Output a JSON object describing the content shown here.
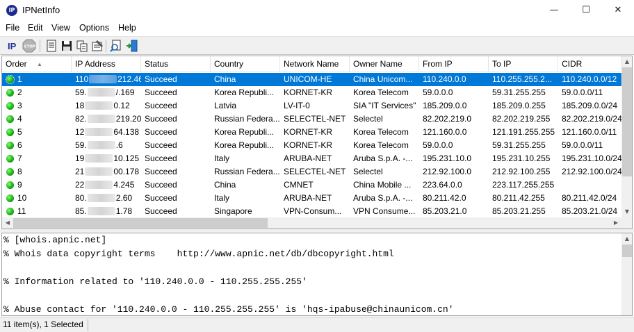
{
  "window": {
    "title": "IPNetInfo",
    "minimize": "—",
    "maximize": "☐",
    "close": "✕",
    "app_icon_text": "IP"
  },
  "menu": [
    "File",
    "Edit",
    "View",
    "Options",
    "Help"
  ],
  "toolbar": {
    "buttons": [
      {
        "name": "ip-lookup-icon",
        "glyph": "IP"
      },
      {
        "name": "stop-icon",
        "glyph": "STOP"
      },
      {
        "name": "text-report-icon",
        "glyph": ""
      },
      {
        "name": "save-icon",
        "glyph": ""
      },
      {
        "name": "copy-icon",
        "glyph": ""
      },
      {
        "name": "properties-icon",
        "glyph": ""
      },
      {
        "name": "find-icon",
        "glyph": ""
      },
      {
        "name": "exit-icon",
        "glyph": ""
      }
    ]
  },
  "columns": [
    "Order",
    "IP Address",
    "Status",
    "Country",
    "Network Name",
    "Owner Name",
    "From IP",
    "To IP",
    "CIDR"
  ],
  "sort_indicator": "▲",
  "rows": [
    {
      "order": "1",
      "ip_start": "110",
      "ip_end": "212.46",
      "status": "Succeed",
      "country": "China",
      "network": "UNICOM-HE",
      "owner": "China Unicom...",
      "from": "110.240.0.0",
      "to": "110.255.255.2...",
      "cidr": "110.240.0.0/12",
      "selected": true
    },
    {
      "order": "2",
      "ip_start": "59.",
      "ip_end": "/.169",
      "status": "Succeed",
      "country": "Korea Republi...",
      "network": "KORNET-KR",
      "owner": "Korea Telecom",
      "from": "59.0.0.0",
      "to": "59.31.255.255",
      "cidr": "59.0.0.0/11"
    },
    {
      "order": "3",
      "ip_start": "18",
      "ip_end": "0.12",
      "status": "Succeed",
      "country": "Latvia",
      "network": "LV-IT-0",
      "owner": "SIA \"IT Services\"",
      "from": "185.209.0.0",
      "to": "185.209.0.255",
      "cidr": "185.209.0.0/24"
    },
    {
      "order": "4",
      "ip_start": "82.",
      "ip_end": "219.202",
      "status": "Succeed",
      "country": "Russian Federa...",
      "network": "SELECTEL-NET",
      "owner": "Selectel",
      "from": "82.202.219.0",
      "to": "82.202.219.255",
      "cidr": "82.202.219.0/24"
    },
    {
      "order": "5",
      "ip_start": "12",
      "ip_end": "64.138",
      "status": "Succeed",
      "country": "Korea Republi...",
      "network": "KORNET-KR",
      "owner": "Korea Telecom",
      "from": "121.160.0.0",
      "to": "121.191.255.255",
      "cidr": "121.160.0.0/11"
    },
    {
      "order": "6",
      "ip_start": "59.",
      "ip_end": ".6",
      "status": "Succeed",
      "country": "Korea Republi...",
      "network": "KORNET-KR",
      "owner": "Korea Telecom",
      "from": "59.0.0.0",
      "to": "59.31.255.255",
      "cidr": "59.0.0.0/11"
    },
    {
      "order": "7",
      "ip_start": "19",
      "ip_end": "10.125",
      "status": "Succeed",
      "country": "Italy",
      "network": "ARUBA-NET",
      "owner": "Aruba S.p.A. -...",
      "from": "195.231.10.0",
      "to": "195.231.10.255",
      "cidr": "195.231.10.0/24"
    },
    {
      "order": "8",
      "ip_start": "21",
      "ip_end": "00.178",
      "status": "Succeed",
      "country": "Russian Federa...",
      "network": "SELECTEL-NET",
      "owner": "Selectel",
      "from": "212.92.100.0",
      "to": "212.92.100.255",
      "cidr": "212.92.100.0/24"
    },
    {
      "order": "9",
      "ip_start": "22",
      "ip_end": "4.245",
      "status": "Succeed",
      "country": "China",
      "network": "CMNET",
      "owner": "China Mobile ...",
      "from": "223.64.0.0",
      "to": "223.117.255.255",
      "cidr": ""
    },
    {
      "order": "10",
      "ip_start": "80.",
      "ip_end": "2.60",
      "status": "Succeed",
      "country": "Italy",
      "network": "ARUBA-NET",
      "owner": "Aruba S.p.A. -...",
      "from": "80.211.42.0",
      "to": "80.211.42.255",
      "cidr": "80.211.42.0/24"
    },
    {
      "order": "11",
      "ip_start": "85.",
      "ip_end": "1.78",
      "status": "Succeed",
      "country": "Singapore",
      "network": "VPN-Consum...",
      "owner": "VPN Consume...",
      "from": "85.203.21.0",
      "to": "85.203.21.255",
      "cidr": "85.203.21.0/24"
    }
  ],
  "whois_lines": [
    "% [whois.apnic.net]",
    "% Whois data copyright terms    http://www.apnic.net/db/dbcopyright.html",
    "",
    "% Information related to '110.240.0.0 - 110.255.255.255'",
    "",
    "% Abuse contact for '110.240.0.0 - 110.255.255.255' is 'hqs-ipabuse@chinaunicom.cn'"
  ],
  "status": {
    "text": "11 item(s), 1 Selected"
  },
  "colors": {
    "selection": "#0078d7",
    "status_dot": "#16a814"
  }
}
